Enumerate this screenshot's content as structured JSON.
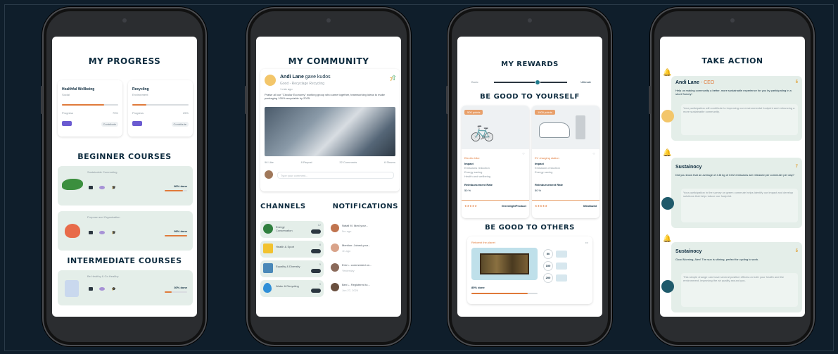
{
  "progress": {
    "title": "MY PROGRESS",
    "cards": [
      {
        "name": "Healthful Wellbeing",
        "sub": "Social",
        "progress_label": "Progress",
        "progress_pct": "75%",
        "progress_value": 0.75,
        "action": "Contribute"
      },
      {
        "name": "Recycling",
        "sub": "Environment",
        "progress_label": "Progress",
        "progress_pct": "25%",
        "progress_value": 0.25,
        "action": "Contribute"
      }
    ],
    "beginner_title": "BEGINNER COURSES",
    "beginner": [
      {
        "name": "Sustainable Commuting",
        "stats": "3   5   2",
        "pct": "80% done",
        "value": 0.8
      },
      {
        "name": "Purpose and Organisation",
        "stats": "4   3   4",
        "pct": "99% done",
        "value": 0.99
      }
    ],
    "intermediate_title": "INTERMEDIATE COURSES",
    "intermediate": [
      {
        "name": "Be Healthy & Go Healthy",
        "stats": "3   3   2",
        "pct": "30% done",
        "value": 0.3
      }
    ]
  },
  "community": {
    "title": "MY COMMUNITY",
    "post": {
      "author": "Andi Lane",
      "action": "gave kudos",
      "topic": "Good - Recyclage Recycling",
      "time": "1 min ago",
      "votes": "7",
      "body": "Praise all our \"Circular Economy\" working group who came together, teamworking ideas to make packaging 100% recyclable by 2025.",
      "reactions": [
        "96 Like",
        "8 Repost",
        "32 Comments",
        "6 Shares"
      ],
      "comment_placeholder": "Type your comment..."
    },
    "channels_title": "CHANNELS",
    "notifications_title": "NOTIFICATIONS",
    "channels": [
      {
        "name": "Energy Conservation",
        "count": "12"
      },
      {
        "name": "Health & Sport",
        "count": "8"
      },
      {
        "name": "Equality & Diversity",
        "count": "5"
      },
      {
        "name": "Water & Recycling",
        "count": "9"
      }
    ],
    "notifications": [
      {
        "text": "Natali M. liked your...",
        "time": "5m ago"
      },
      {
        "text": "Mention: Joined your...",
        "time": "1h ago"
      },
      {
        "text": "Erin L. commented on...",
        "time": "Yesterday"
      },
      {
        "text": "Ben L. Registered to...",
        "time": "Jun 27, 2024"
      }
    ]
  },
  "rewards": {
    "title": "MY REWARDS",
    "slider_left": "Basic",
    "slider_right": "Ultimate",
    "slider_value": 0.6,
    "self_title": "BE GOOD TO YOURSELF",
    "self_items": [
      {
        "badge": "500 points",
        "name": "Electric bike",
        "impact_label": "Impact",
        "impacts": [
          "Emissions reduction",
          "Energy saving",
          "Health and wellbeing"
        ],
        "partner_label": "Reimbursement Rate",
        "rate": "50 %",
        "brand": "GreenlightProduct"
      },
      {
        "badge": "1000 points",
        "name": "EV charging station",
        "impact_label": "Impact",
        "impacts": [
          "Emissions reduction",
          "Energy saving"
        ],
        "partner_label": "Reimbursement Rate",
        "rate": "50 %",
        "brand": "Mindbuild"
      }
    ],
    "others_title": "BE GOOD TO OTHERS",
    "others": {
      "name": "Reforest the planet",
      "pct": "85% done",
      "value": 0.85,
      "options": [
        "50",
        "100",
        "200"
      ]
    }
  },
  "action": {
    "title": "TAKE ACTION",
    "items": [
      {
        "author": "Andi Lane",
        "role": "CEO",
        "score": "5",
        "headline": "Help us making community a better, more sustainable experience for you by participating in a short Survey!",
        "body": "Your participation will contribute to improving our environmental footprint and enhancing a more sustainable community."
      },
      {
        "author": "Sustainocy",
        "role": "",
        "score": "7",
        "headline": "Did you know that an average of 4.6t kg of CO2 emissions are released per commuter per day?",
        "body": "Your participation in the survey on green commute helps identify our impact and develop solutions that help reduce our footprint."
      },
      {
        "author": "Sustainocy",
        "role": "",
        "score": "5",
        "headline": "Good Morning, Alex! The sun is shining, perfect for cycling to work.",
        "body": "This simple change can have several positive effects on both your health and the environment, improving the air quality around you."
      }
    ]
  }
}
